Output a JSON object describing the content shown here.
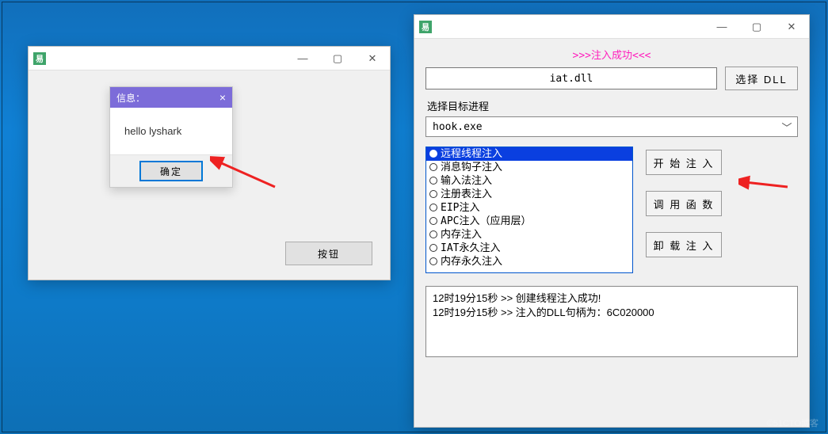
{
  "watermark": "©51CTO博客",
  "left_window": {
    "button_label": "按钮"
  },
  "msgbox": {
    "title": "信息：",
    "body": "hello lyshark",
    "ok_label": "确定"
  },
  "right_window": {
    "status": ">>>注入成功<<<",
    "dll_path": "iat.dll",
    "choose_dll_label": "选择 DLL",
    "target_label": "选择目标进程",
    "target_value": "hook.exe",
    "options": [
      "远程线程注入",
      "消息钩子注入",
      "输入法注入",
      "注册表注入",
      "EIP注入",
      "APC注入（应用层）",
      "内存注入",
      "IAT永久注入",
      "内存永久注入"
    ],
    "selected_index": 0,
    "btn_start": "开 始 注 入",
    "btn_call": "调 用 函 数",
    "btn_unload": "卸 载 注 入",
    "log": [
      "12时19分15秒 >> 创建线程注入成功!",
      "12时19分15秒 >> 注入的DLL句柄为：6C020000"
    ]
  }
}
